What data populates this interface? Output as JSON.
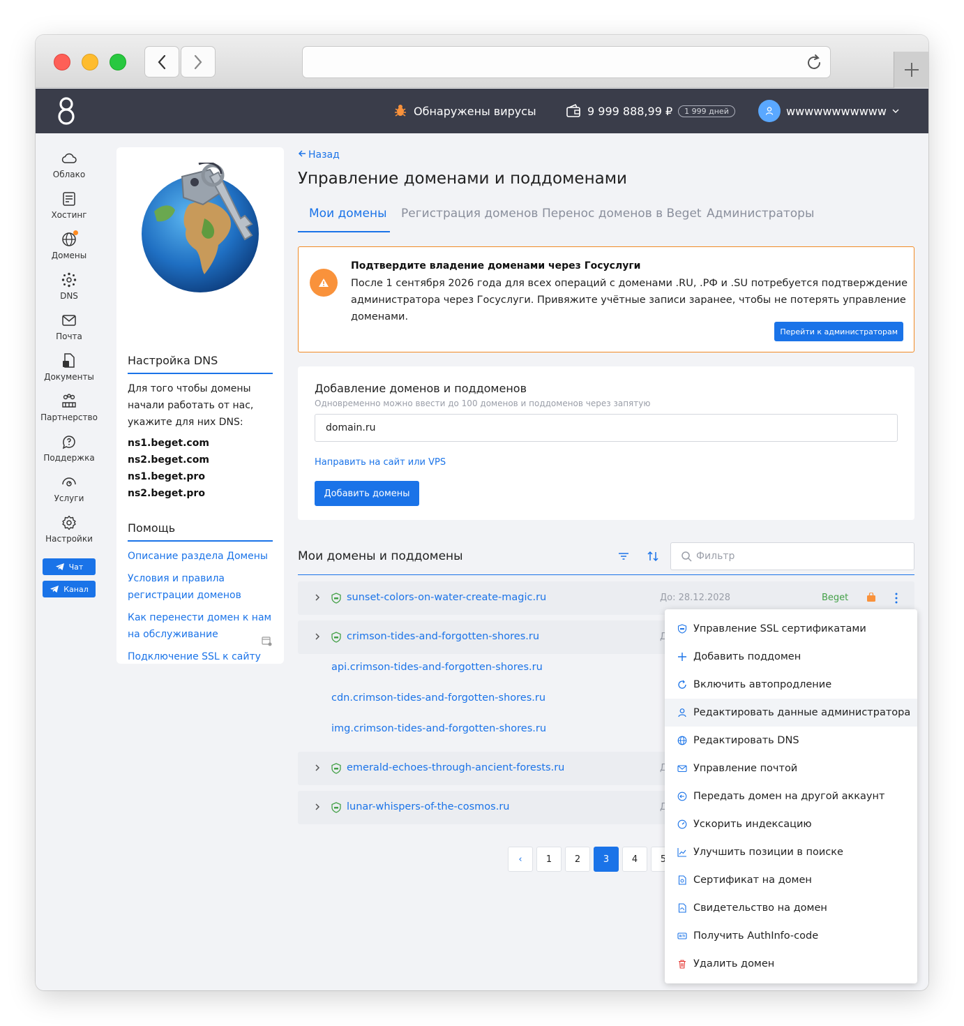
{
  "header": {
    "virus_text": "Обнаружены вирусы",
    "balance": "9 999 888,99 ₽",
    "days": "1 999 дней",
    "username": "wwwwwwwwwww"
  },
  "sidebar": {
    "items": [
      {
        "label": "Облако",
        "icon": "cloud-icon"
      },
      {
        "label": "Хостинг",
        "icon": "hosting-icon"
      },
      {
        "label": "Домены",
        "icon": "globe-icon"
      },
      {
        "label": "DNS",
        "icon": "dns-icon"
      },
      {
        "label": "Почта",
        "icon": "mail-icon"
      },
      {
        "label": "Документы",
        "icon": "documents-icon"
      },
      {
        "label": "Партнерство",
        "icon": "partnership-icon"
      },
      {
        "label": "Поддержка",
        "icon": "support-icon"
      },
      {
        "label": "Услуги",
        "icon": "services-icon"
      },
      {
        "label": "Настройки",
        "icon": "gear-icon"
      }
    ],
    "chat": "Чат",
    "channel": "Канал"
  },
  "info_card": {
    "dns_title": "Настройка DNS",
    "dns_text": "Для того чтобы домены начали работать от нас, укажите для них DNS:",
    "ns": [
      "ns1.beget.com",
      "ns2.beget.com",
      "ns1.beget.pro",
      "ns2.beget.pro"
    ],
    "help_title": "Помощь",
    "help_links": [
      "Описание раздела Домены",
      "Условия и правила регистрации доменов",
      "Как перенести домен к нам на обслуживание",
      "Подключение SSL к сайту"
    ]
  },
  "main": {
    "back": "Назад",
    "title": "Управление доменами и поддоменами",
    "tabs": [
      "Мои домены",
      "Регистрация доменов",
      "Перенос доменов в Beget",
      "Администраторы"
    ]
  },
  "alert": {
    "title": "Подтвердите владение доменами через Госуслуги",
    "text": "После 1 сентября 2026 года для всех операций с доменами .RU, .РФ и .SU потребуется подтверждение администратора через Госуслуги. Привяжите учётные записи заранее, чтобы не потерять управление доменами.",
    "button": "Перейти к администраторам"
  },
  "add_domains": {
    "title": "Добавление доменов и поддоменов",
    "subtitle": "Одновременно можно ввести до 100 доменов и поддоменов через запятую",
    "input_value": "domain.ru",
    "link": "Направить на сайт или VPS",
    "button": "Добавить домены"
  },
  "domains": {
    "title": "Мои домены и поддомены",
    "filter_placeholder": "Фильтр",
    "rows": [
      {
        "name": "sunset-colors-on-water-create-magic.ru",
        "date": "До: 28.12.2028",
        "registrar": "Beget"
      },
      {
        "name": "crimson-tides-and-forgotten-shores.ru",
        "date": "Д"
      },
      {
        "name": "emerald-echoes-through-ancient-forests.ru",
        "date": "Д"
      },
      {
        "name": "lunar-whispers-of-the-cosmos.ru",
        "date": "Д"
      }
    ],
    "subdomains": [
      "api.crimson-tides-and-forgotten-shores.ru",
      "cdn.crimson-tides-and-forgotten-shores.ru",
      "img.crimson-tides-and-forgotten-shores.ru"
    ]
  },
  "pagination": {
    "prev": "‹",
    "pages": [
      "1",
      "2",
      "3",
      "4",
      "5"
    ],
    "current": "3"
  },
  "menu": {
    "items": [
      {
        "label": "Управление SSL сертификатами",
        "icon": "ssl-icon"
      },
      {
        "label": "Добавить поддомен",
        "icon": "plus-icon"
      },
      {
        "label": "Включить автопродление",
        "icon": "refresh-icon"
      },
      {
        "label": "Редактировать данные администратора",
        "icon": "user-icon"
      },
      {
        "label": "Редактировать DNS",
        "icon": "globe-icon"
      },
      {
        "label": "Управление почтой",
        "icon": "mail-icon"
      },
      {
        "label": "Передать домен на другой аккаунт",
        "icon": "transfer-icon"
      },
      {
        "label": "Ускорить индексацию",
        "icon": "speed-icon"
      },
      {
        "label": "Улучшить позиции в поиске",
        "icon": "chart-icon"
      },
      {
        "label": "Сертификат на домен",
        "icon": "certificate-icon"
      },
      {
        "label": "Свидетельство на домен",
        "icon": "document-icon"
      },
      {
        "label": "Получить AuthInfo-code",
        "icon": "auth-icon"
      },
      {
        "label": "Удалить домен",
        "icon": "trash-icon"
      }
    ]
  },
  "colors": {
    "accent": "#1a73e8",
    "header_bg": "#3a3d4a",
    "warning": "#f9923b",
    "success": "#43a047"
  }
}
